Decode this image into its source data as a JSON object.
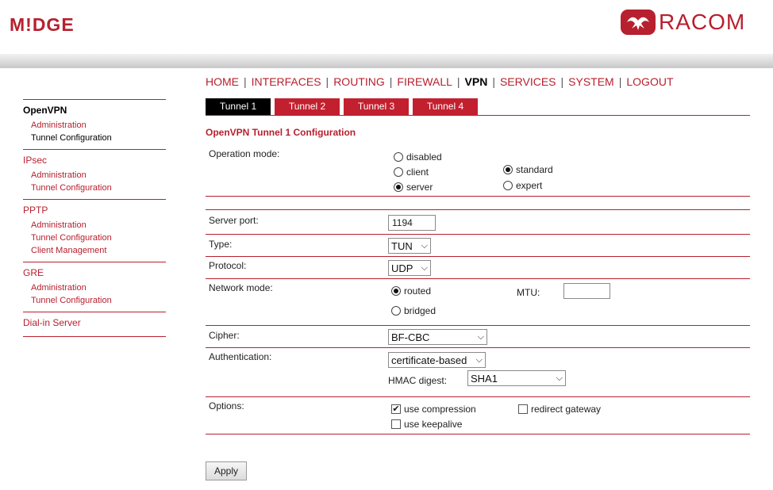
{
  "brand": {
    "left": "M!DGE",
    "right": "RACOM"
  },
  "colors": {
    "accent": "#b7202e",
    "tab_active": "#000000"
  },
  "topnav": [
    {
      "label": "HOME",
      "active": false
    },
    {
      "label": "INTERFACES",
      "active": false
    },
    {
      "label": "ROUTING",
      "active": false
    },
    {
      "label": "FIREWALL",
      "active": false
    },
    {
      "label": "VPN",
      "active": true
    },
    {
      "label": "SERVICES",
      "active": false
    },
    {
      "label": "SYSTEM",
      "active": false
    },
    {
      "label": "LOGOUT",
      "active": false
    }
  ],
  "sidebar": [
    {
      "head": "OpenVPN",
      "items": [
        "Administration",
        "Tunnel Configuration"
      ]
    },
    {
      "head": "IPsec",
      "items": [
        "Administration",
        "Tunnel Configuration"
      ]
    },
    {
      "head": "PPTP",
      "items": [
        "Administration",
        "Tunnel Configuration",
        "Client Management"
      ]
    },
    {
      "head": "GRE",
      "items": [
        "Administration",
        "Tunnel Configuration"
      ]
    },
    {
      "head": "Dial-in Server",
      "items": []
    }
  ],
  "tabs": [
    "Tunnel 1",
    "Tunnel 2",
    "Tunnel 3",
    "Tunnel 4"
  ],
  "section_title": "OpenVPN Tunnel 1 Configuration",
  "operation_mode": {
    "label": "Operation mode:",
    "opt_disabled": "disabled",
    "opt_client": "client",
    "opt_server": "server",
    "opt_standard": "standard",
    "opt_expert": "expert"
  },
  "server_port": {
    "label": "Server port:",
    "value": "1194"
  },
  "type": {
    "label": "Type:",
    "value": "TUN"
  },
  "protocol": {
    "label": "Protocol:",
    "value": "UDP"
  },
  "network_mode": {
    "label": "Network mode:",
    "opt_routed": "routed",
    "opt_bridged": "bridged",
    "mtu_label": "MTU:",
    "mtu_value": ""
  },
  "cipher": {
    "label": "Cipher:",
    "value": "BF-CBC"
  },
  "authentication": {
    "label": "Authentication:",
    "value": "certificate-based",
    "hmac_label": "HMAC digest:",
    "hmac_value": "SHA1"
  },
  "options": {
    "label": "Options:",
    "compression": "use compression",
    "keepalive": "use keepalive",
    "redirect": "redirect gateway"
  },
  "apply_label": "Apply"
}
